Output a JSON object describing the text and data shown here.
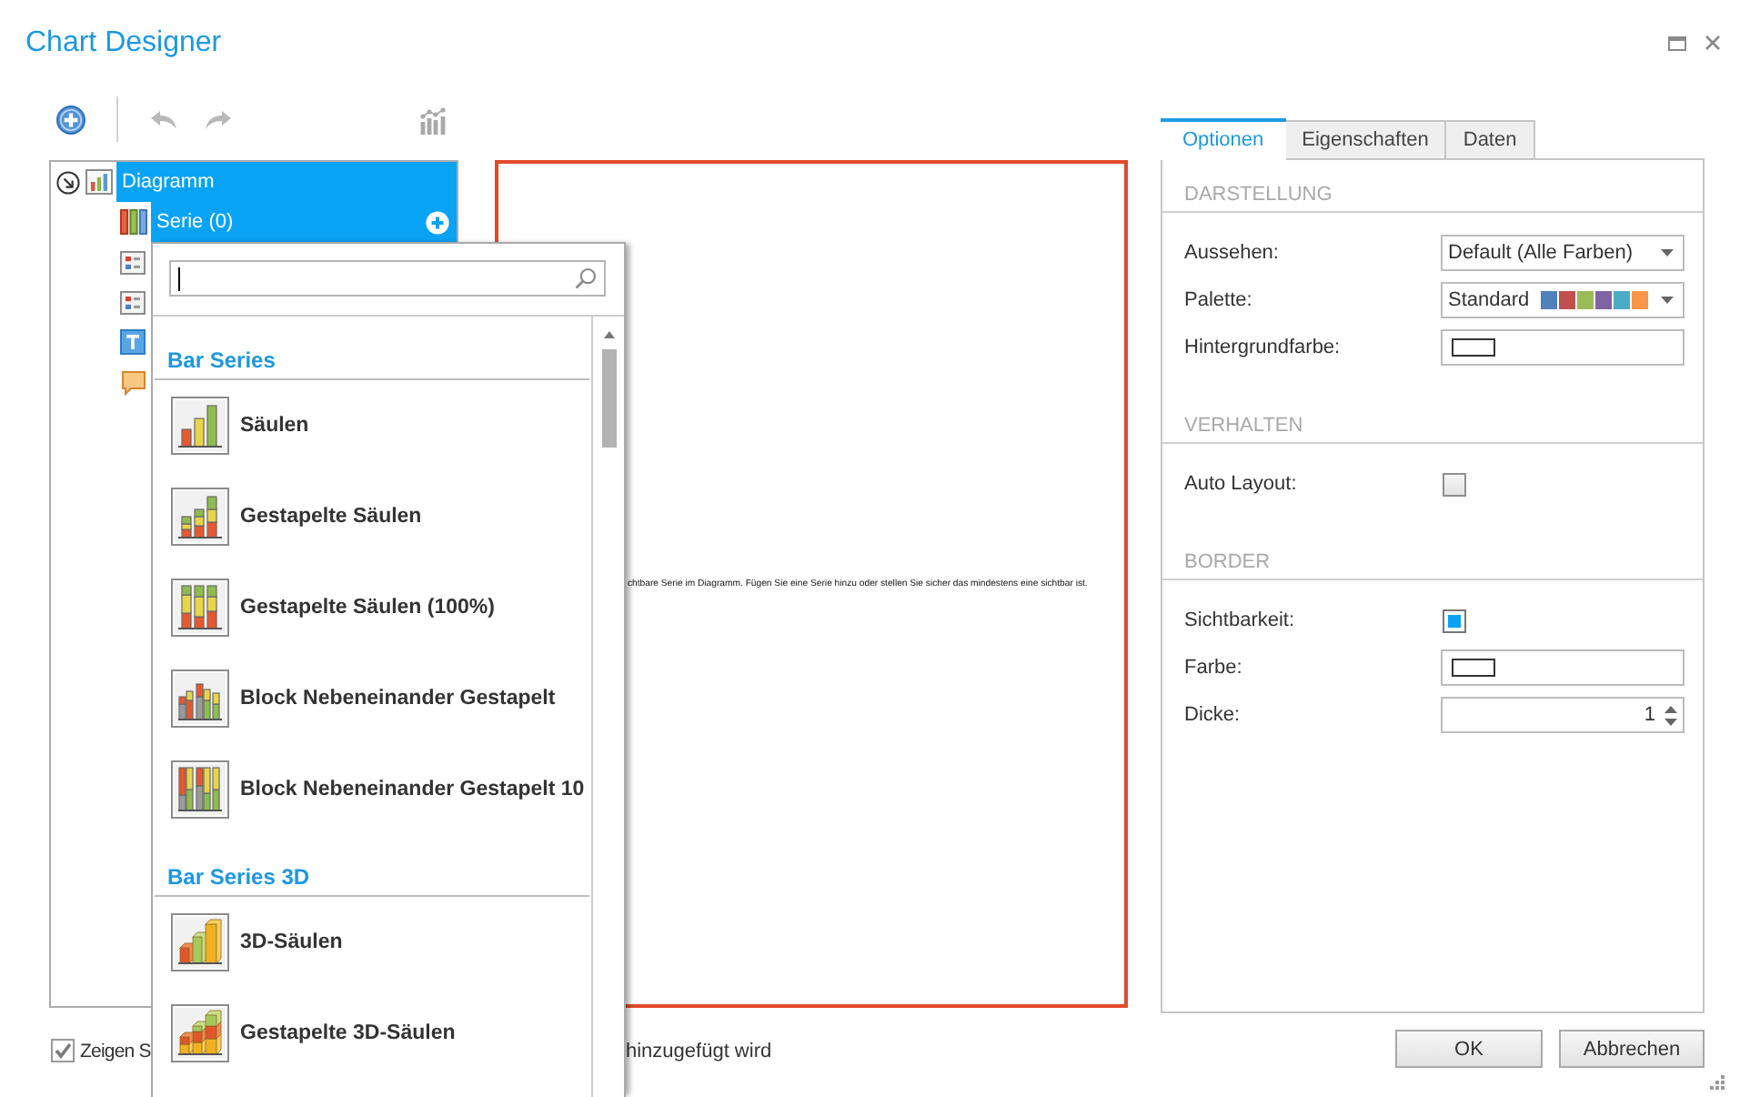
{
  "window": {
    "title": "Chart Designer"
  },
  "toolbar": [
    {
      "kind": "add",
      "disabled": false
    },
    {
      "kind": "undo",
      "disabled": true
    },
    {
      "kind": "redo",
      "disabled": true
    },
    {
      "kind": "chart",
      "disabled": true
    }
  ],
  "tree": [
    {
      "label": "Diagramm",
      "kind": "chart",
      "selected": true,
      "expanded": true,
      "children": [
        {
          "label": "Serie (0)",
          "kind": "series",
          "selected": true
        },
        {
          "kind": "legend",
          "selected": false
        },
        {
          "kind": "legend",
          "selected": false
        },
        {
          "kind": "title",
          "selected": false
        },
        {
          "kind": "annotation",
          "selected": false
        }
      ]
    }
  ],
  "chart_preview": {
    "message": "chtbare Serie im Diagramm. Fügen Sie eine Serie hinzu oder stellen Sie sicher das mindestens eine sichtbar ist."
  },
  "show_wizard": {
    "checked": true,
    "label_parts": [
      "Zeigen S",
      "hinzugefügt wird"
    ]
  },
  "series_picker": {
    "search": {
      "focused": true
    },
    "groups": [
      {
        "title": "Bar Series",
        "items": [
          {
            "label": "Säulen",
            "kind": "bar"
          },
          {
            "label": "Gestapelte Säulen",
            "kind": "stacked"
          },
          {
            "label": "Gestapelte Säulen (100%)",
            "kind": "stacked100"
          },
          {
            "label": "Block Nebeneinander Gestapelt",
            "kind": "side_stacked"
          },
          {
            "label": "Block Nebeneinander Gestapelt 10",
            "kind": "side_stacked100"
          }
        ]
      },
      {
        "title": "Bar Series 3D",
        "items": [
          {
            "label": "3D-Säulen",
            "kind": "bar3d"
          },
          {
            "label": "Gestapelte 3D-Säulen",
            "kind": "stacked3d"
          }
        ]
      }
    ]
  },
  "properties": {
    "tabs": [
      {
        "label": "Optionen",
        "selected": true
      },
      {
        "label": "Eigenschaften",
        "selected": false
      },
      {
        "label": "Daten",
        "selected": false
      }
    ],
    "sections": [
      {
        "title": "DARSTELLUNG",
        "fields": [
          {
            "label": "Aussehen:",
            "kind": "dropdown",
            "value": "Default (Alle Farben)"
          },
          {
            "label": "Palette:",
            "kind": "palette",
            "value": "Standard",
            "swatches": [
              {
                "color": "#4f81bd"
              },
              {
                "color": "#c0504d"
              },
              {
                "color": "#9bbb59"
              },
              {
                "color": "#8064a2"
              },
              {
                "color": "#4bacc6"
              },
              {
                "color": "#f79646"
              }
            ]
          },
          {
            "label": "Hintergrundfarbe:",
            "kind": "color",
            "color": "#ffffff"
          }
        ]
      },
      {
        "title": "VERHALTEN",
        "fields": [
          {
            "label": "Auto Layout:",
            "kind": "checkbox",
            "checked": false
          }
        ]
      },
      {
        "title": "BORDER",
        "fields": [
          {
            "label": "Sichtbarkeit:",
            "kind": "checkbox",
            "checked": true
          },
          {
            "label": "Farbe:",
            "kind": "color",
            "color": "#ffffff"
          },
          {
            "label": "Dicke:",
            "kind": "spinner",
            "value": "1"
          }
        ]
      }
    ]
  },
  "buttons": [
    "OK",
    "Abbrechen"
  ]
}
